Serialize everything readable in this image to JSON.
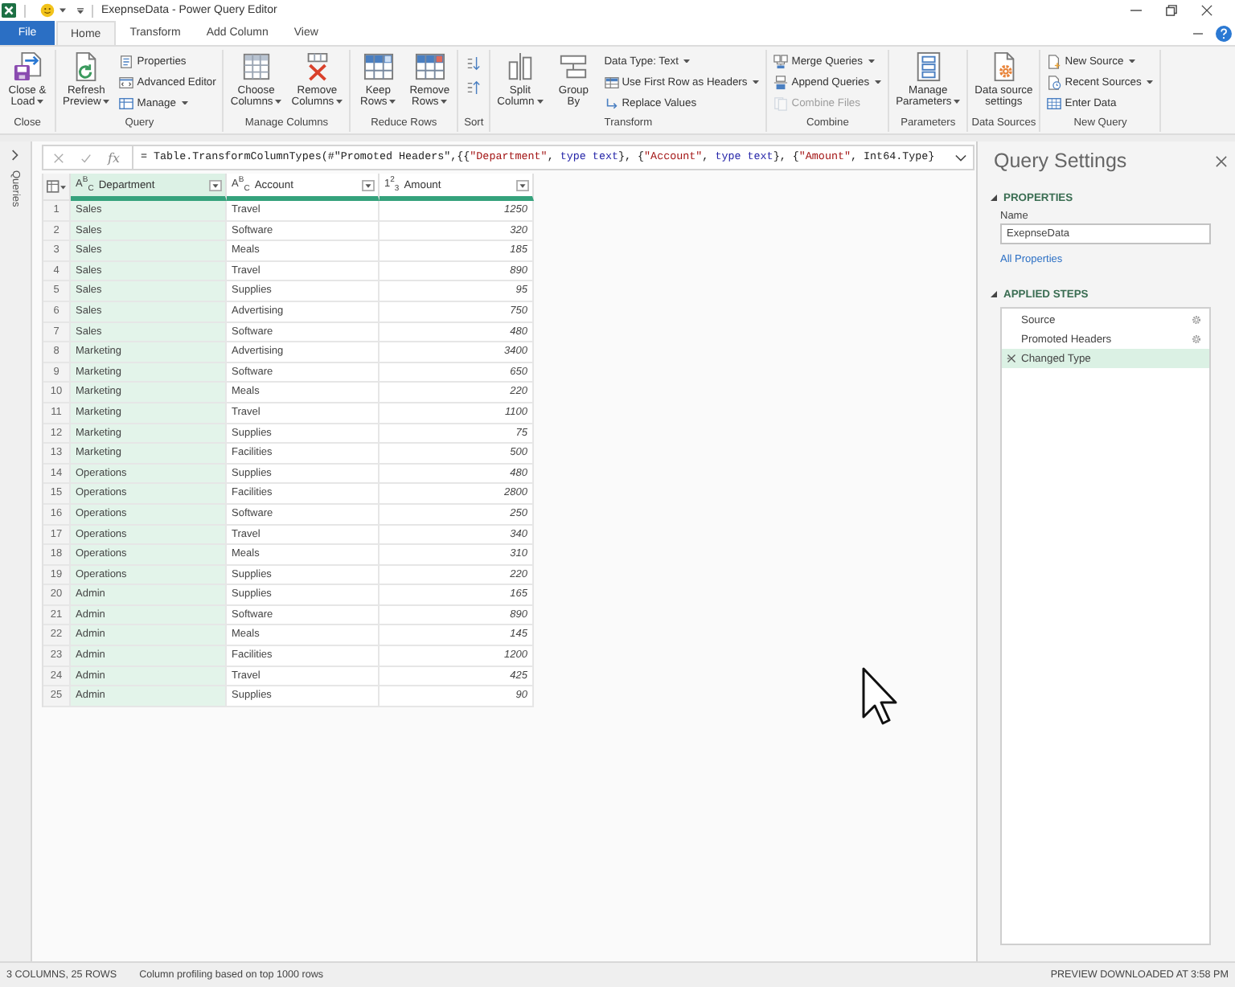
{
  "title_bar": {
    "title": "ExepnseData - Power Query Editor"
  },
  "ribbon_tabs": [
    {
      "label": "File",
      "kind": "file",
      "selected": false
    },
    {
      "label": "Home",
      "kind": "tab",
      "selected": true
    },
    {
      "label": "Transform",
      "kind": "tab",
      "selected": false
    },
    {
      "label": "Add Column",
      "kind": "tab",
      "selected": false
    },
    {
      "label": "View",
      "kind": "tab",
      "selected": false
    }
  ],
  "ribbon_groups": [
    {
      "label": "Close",
      "items": [
        {
          "kind": "large",
          "label": "Close &\nLoad",
          "dropdown": true,
          "disabled": false
        }
      ]
    },
    {
      "label": "Query",
      "items": [
        {
          "kind": "large",
          "label": "Refresh\nPreview",
          "dropdown": true,
          "disabled": false
        },
        {
          "kind": "small",
          "label": "Properties",
          "dropdown": false,
          "disabled": false
        },
        {
          "kind": "small",
          "label": "Advanced Editor",
          "dropdown": false,
          "disabled": false
        },
        {
          "kind": "small",
          "label": "Manage",
          "dropdown": true,
          "disabled": false
        }
      ]
    },
    {
      "label": "Manage Columns",
      "items": [
        {
          "kind": "large",
          "label": "Choose\nColumns",
          "dropdown": true,
          "disabled": false
        },
        {
          "kind": "large",
          "label": "Remove\nColumns",
          "dropdown": true,
          "disabled": false
        }
      ]
    },
    {
      "label": "Reduce Rows",
      "items": [
        {
          "kind": "large",
          "label": "Keep\nRows",
          "dropdown": true,
          "disabled": false
        },
        {
          "kind": "large",
          "label": "Remove\nRows",
          "dropdown": true,
          "disabled": false
        }
      ]
    },
    {
      "label": "Sort",
      "items": [
        {
          "kind": "icon",
          "dropdown": false,
          "disabled": false
        },
        {
          "kind": "icon",
          "dropdown": false,
          "disabled": false
        }
      ]
    },
    {
      "label": "Transform",
      "items": [
        {
          "kind": "large",
          "label": "Split\nColumn",
          "dropdown": true,
          "disabled": false
        },
        {
          "kind": "large",
          "label": "Group\nBy",
          "dropdown": false,
          "disabled": false
        },
        {
          "kind": "small",
          "label": "Data Type: Text",
          "dropdown": true,
          "disabled": false
        },
        {
          "kind": "small",
          "label": "Use First Row as Headers",
          "dropdown": true,
          "disabled": false
        },
        {
          "kind": "small",
          "label": "Replace Values",
          "dropdown": false,
          "disabled": false
        }
      ]
    },
    {
      "label": "Combine",
      "items": [
        {
          "kind": "small",
          "label": "Merge Queries",
          "dropdown": true,
          "disabled": false
        },
        {
          "kind": "small",
          "label": "Append Queries",
          "dropdown": true,
          "disabled": false
        },
        {
          "kind": "small",
          "label": "Combine Files",
          "dropdown": false,
          "disabled": true
        }
      ]
    },
    {
      "label": "Parameters",
      "items": [
        {
          "kind": "large",
          "label": "Manage\nParameters",
          "dropdown": true,
          "disabled": false
        }
      ]
    },
    {
      "label": "Data Sources",
      "items": [
        {
          "kind": "large",
          "label": "Data source\nsettings",
          "dropdown": false,
          "disabled": false
        }
      ]
    },
    {
      "label": "New Query",
      "items": [
        {
          "kind": "small",
          "label": "New Source",
          "dropdown": true,
          "disabled": false
        },
        {
          "kind": "small",
          "label": "Recent Sources",
          "dropdown": true,
          "disabled": false
        },
        {
          "kind": "small",
          "label": "Enter Data",
          "dropdown": false,
          "disabled": false
        }
      ]
    }
  ],
  "queries_pane": {
    "label": "Queries",
    "expanded": false
  },
  "formula_bar": {
    "function_button": "fx",
    "formula": [
      {
        "kind": "plain",
        "text": "= Table.TransformColumnTypes(#\"Promoted Headers\",{{"
      },
      {
        "kind": "string",
        "text": "\"Department\""
      },
      {
        "kind": "plain",
        "text": ", "
      },
      {
        "kind": "keyword",
        "text": "type text"
      },
      {
        "kind": "plain",
        "text": "}, {"
      },
      {
        "kind": "string",
        "text": "\"Account\""
      },
      {
        "kind": "plain",
        "text": ", "
      },
      {
        "kind": "keyword",
        "text": "type text"
      },
      {
        "kind": "plain",
        "text": "}, {"
      },
      {
        "kind": "string",
        "text": "\"Amount\""
      },
      {
        "kind": "plain",
        "text": ", Int64.Type}"
      }
    ]
  },
  "table": {
    "columns": [
      {
        "name": "Department",
        "type": "A$^{B}$$_{C}$",
        "kind": "text",
        "selected": true
      },
      {
        "name": "Account",
        "type": "A$^{B}$$_{C}$",
        "kind": "text",
        "selected": false
      },
      {
        "name": "Amount",
        "type": "1$^{2}$$_{3}$",
        "kind": "number",
        "selected": false
      }
    ],
    "rows": [
      {
        "number": "1",
        "cells": [
          "Sales",
          "Travel",
          "1250"
        ]
      },
      {
        "number": "2",
        "cells": [
          "Sales",
          "Software",
          "320"
        ]
      },
      {
        "number": "3",
        "cells": [
          "Sales",
          "Meals",
          "185"
        ]
      },
      {
        "number": "4",
        "cells": [
          "Sales",
          "Travel",
          "890"
        ]
      },
      {
        "number": "5",
        "cells": [
          "Sales",
          "Supplies",
          "95"
        ]
      },
      {
        "number": "6",
        "cells": [
          "Sales",
          "Advertising",
          "750"
        ]
      },
      {
        "number": "7",
        "cells": [
          "Sales",
          "Software",
          "480"
        ]
      },
      {
        "number": "8",
        "cells": [
          "Marketing",
          "Advertising",
          "3400"
        ]
      },
      {
        "number": "9",
        "cells": [
          "Marketing",
          "Software",
          "650"
        ]
      },
      {
        "number": "10",
        "cells": [
          "Marketing",
          "Meals",
          "220"
        ]
      },
      {
        "number": "11",
        "cells": [
          "Marketing",
          "Travel",
          "1100"
        ]
      },
      {
        "number": "12",
        "cells": [
          "Marketing",
          "Supplies",
          "75"
        ]
      },
      {
        "number": "13",
        "cells": [
          "Marketing",
          "Facilities",
          "500"
        ]
      },
      {
        "number": "14",
        "cells": [
          "Operations",
          "Supplies",
          "480"
        ]
      },
      {
        "number": "15",
        "cells": [
          "Operations",
          "Facilities",
          "2800"
        ]
      },
      {
        "number": "16",
        "cells": [
          "Operations",
          "Software",
          "250"
        ]
      },
      {
        "number": "17",
        "cells": [
          "Operations",
          "Travel",
          "340"
        ]
      },
      {
        "number": "18",
        "cells": [
          "Operations",
          "Meals",
          "310"
        ]
      },
      {
        "number": "19",
        "cells": [
          "Operations",
          "Supplies",
          "220"
        ]
      },
      {
        "number": "20",
        "cells": [
          "Admin",
          "Supplies",
          "165"
        ]
      },
      {
        "number": "21",
        "cells": [
          "Admin",
          "Software",
          "890"
        ]
      },
      {
        "number": "22",
        "cells": [
          "Admin",
          "Meals",
          "145"
        ]
      },
      {
        "number": "23",
        "cells": [
          "Admin",
          "Facilities",
          "1200"
        ]
      },
      {
        "number": "24",
        "cells": [
          "Admin",
          "Travel",
          "425"
        ]
      },
      {
        "number": "25",
        "cells": [
          "Admin",
          "Supplies",
          "90"
        ]
      }
    ]
  },
  "query_settings": {
    "title": "Query Settings",
    "properties": {
      "heading": "PROPERTIES",
      "expanded": true,
      "name_label": "Name",
      "name_value": "ExepnseData",
      "link": "All Properties"
    },
    "applied_steps": {
      "heading": "APPLIED STEPS",
      "expanded": true,
      "steps": [
        {
          "label": "Source",
          "selected": false,
          "settings": true
        },
        {
          "label": "Promoted Headers",
          "selected": false,
          "settings": true
        },
        {
          "label": "Changed Type",
          "selected": true,
          "settings": false
        }
      ]
    }
  },
  "status_bar": {
    "summary": "3 COLUMNS, 25 ROWS",
    "profiling": "Column profiling based on top 1000 rows",
    "preview": "PREVIEW DOWNLOADED AT 3:58 PM"
  }
}
